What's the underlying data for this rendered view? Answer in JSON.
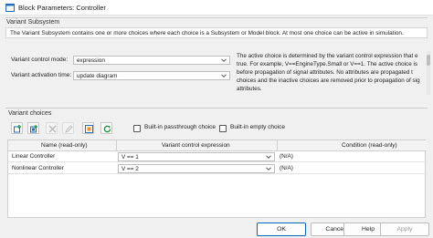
{
  "window": {
    "title": "Block Parameters: Controller"
  },
  "subsystem": {
    "group_label": "Variant Subsystem",
    "description": "The Variant Subsystem contains one or more choices where each choice is a Subsystem or Model block. At most one choice can be active in simulation."
  },
  "params": {
    "control_mode_label": "Variant control mode:",
    "control_mode_value": "expression",
    "activation_time_label": "Variant activation time:",
    "activation_time_value": "update diagram",
    "info_lines": [
      "The active choice is determined by the variant control expression that e",
      "true. For example, V==EngineType.Small or V==1. The active choice is",
      "before propagation of signal attributes. No attributes are propagated t",
      "choices and the inactive choices are removed prior to propagation of sig",
      "attributes."
    ]
  },
  "variant_choices": {
    "group_label": "Variant choices",
    "passthrough_label": "Built-in passthrough choice",
    "empty_label": "Built-in empty choice"
  },
  "table": {
    "headers": [
      "Name (read-only)",
      "Variant control expression",
      "Condition (read-only)"
    ],
    "rows": [
      {
        "name": "Linear Controller",
        "expression": "V == 1",
        "condition": "(N/A)"
      },
      {
        "name": "Nonlinear Controller",
        "expression": "V == 2",
        "condition": "(N/A)"
      }
    ]
  },
  "buttons": {
    "ok": "OK",
    "cancel": "Cancel",
    "help": "Help",
    "apply": "Apply"
  },
  "colors": {
    "accent": "#0067c0",
    "icon_green": "#1a8f3a",
    "icon_orange": "#e8912d"
  }
}
